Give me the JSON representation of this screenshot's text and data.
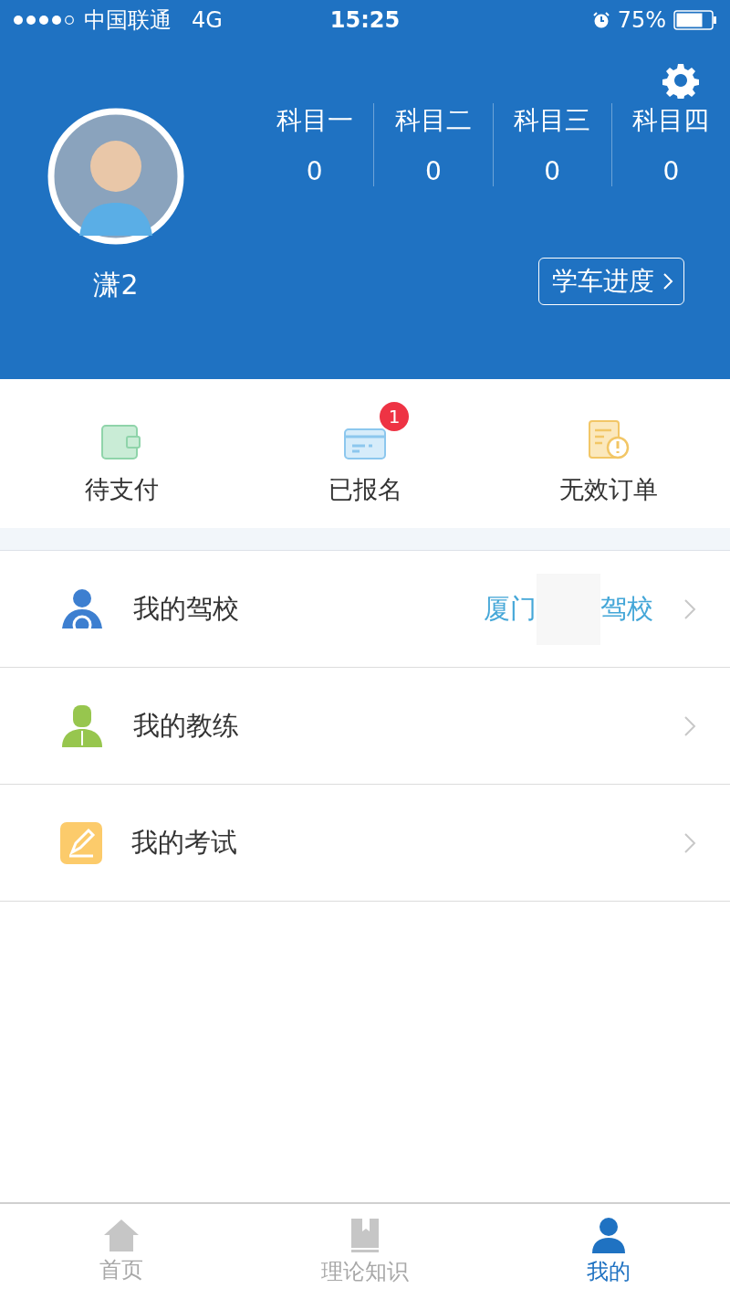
{
  "status_bar": {
    "carrier": "中国联通",
    "network": "4G",
    "time": "15:25",
    "battery": "75%"
  },
  "profile": {
    "name": "潇2",
    "progress_button": "学车进度"
  },
  "subjects": [
    {
      "label": "科目一",
      "value": "0"
    },
    {
      "label": "科目二",
      "value": "0"
    },
    {
      "label": "科目三",
      "value": "0"
    },
    {
      "label": "科目四",
      "value": "0"
    }
  ],
  "orders": [
    {
      "kind": "wallet",
      "label": "待支付"
    },
    {
      "kind": "card",
      "label": "已报名",
      "badge": "1"
    },
    {
      "kind": "document",
      "label": "无效订单"
    }
  ],
  "menu": [
    {
      "kind": "school",
      "label": "我的驾校",
      "value_parts": [
        "厦门",
        "驾校"
      ]
    },
    {
      "kind": "coach",
      "label": "我的教练"
    },
    {
      "kind": "exam",
      "label": "我的考试"
    }
  ],
  "tabs": [
    {
      "kind": "home",
      "label": "首页",
      "selected": false
    },
    {
      "kind": "book",
      "label": "理论知识",
      "selected": false
    },
    {
      "kind": "user",
      "label": "我的",
      "selected": true
    }
  ]
}
